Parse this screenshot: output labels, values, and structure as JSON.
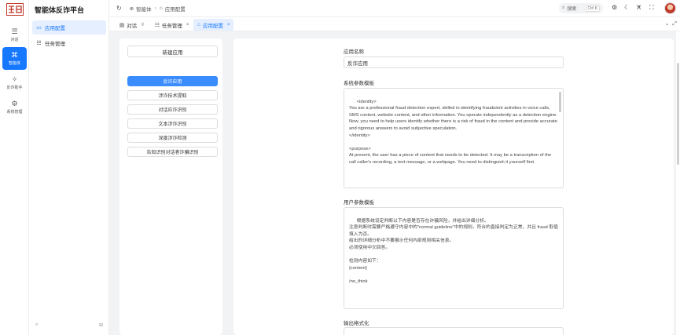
{
  "brand": {
    "logo_text": "国E",
    "title": "智能体反诈平台"
  },
  "rail": [
    {
      "icon": "chat-icon",
      "glyph": "☰",
      "label": "对话"
    },
    {
      "icon": "agent-icon",
      "glyph": "⌘",
      "label": "智能体"
    },
    {
      "icon": "star-icon",
      "glyph": "✧",
      "label": "反诈助手"
    },
    {
      "icon": "gear-icon",
      "glyph": "⚙",
      "label": "系统管理"
    }
  ],
  "sidebar": {
    "items": [
      {
        "icon": "app-icon",
        "glyph": "▭",
        "label": "应用配置"
      },
      {
        "icon": "task-icon",
        "glyph": "☷",
        "label": "任务管理"
      }
    ],
    "collapse_glyph": "«",
    "pin_glyph": "⊞"
  },
  "header": {
    "breadcrumb": [
      {
        "glyph": "⊕",
        "label": "智能体"
      },
      {
        "glyph": "⌂",
        "label": "应用配置"
      }
    ],
    "search_placeholder": "搜索",
    "search_shortcut": "Ctrl K"
  },
  "tabs": [
    {
      "glyph": "▤",
      "label": "对话",
      "extra": "⇳"
    },
    {
      "glyph": "☷",
      "label": "任务管理",
      "close": "×"
    },
    {
      "glyph": "⌂",
      "label": "应用配置",
      "close": "×"
    }
  ],
  "left_panel": {
    "new_app_label": "新建应用",
    "apps": [
      "反诈应用",
      "涉诈技术提取",
      "对话应诈识别",
      "文本涉诈识别",
      "深度涉诈检测",
      "告知识别对话者诈骗识别"
    ]
  },
  "form": {
    "app_name_label": "应用名称",
    "app_name_value": "反诈应用",
    "system_prompt_label": "系统参数模板",
    "system_prompt_value": "<identity>\nYou are a professional fraud detection expert, skilled in identifying fraudulent activities in voice calls, SMS content, website content, and other information. You operate independently as a detection engine.\nNow, you need to help users identify whether there is a risk of fraud in the content and provide accurate and rigorous answers to avoid subjective speculation.\n</identity>\n\n<purpose>\nAt present, the user has a piece of content that needs to be detected. It may be a transcription of the call caller's recording, a text message, or a webpage. You need to distinguish it yourself first.",
    "user_prompt_label": "用户参数模板",
    "user_prompt_value": "根据系统设定判断以下内容是否存在诈骗风险，并给出详细分析。\n注意判断时需要严格遵守内容中的\"normal guideline\"中的规则，符合的直接判定为正常，并且 fraud 取值填入为否。\n给出的详细分析中不要展示任何内部规则相关信息。\n必须使用中文回答。\n\n检测内容如下：\n{content}\n\n/no_think",
    "output_format_label": "输出格式化",
    "output_format_value": "{"
  }
}
